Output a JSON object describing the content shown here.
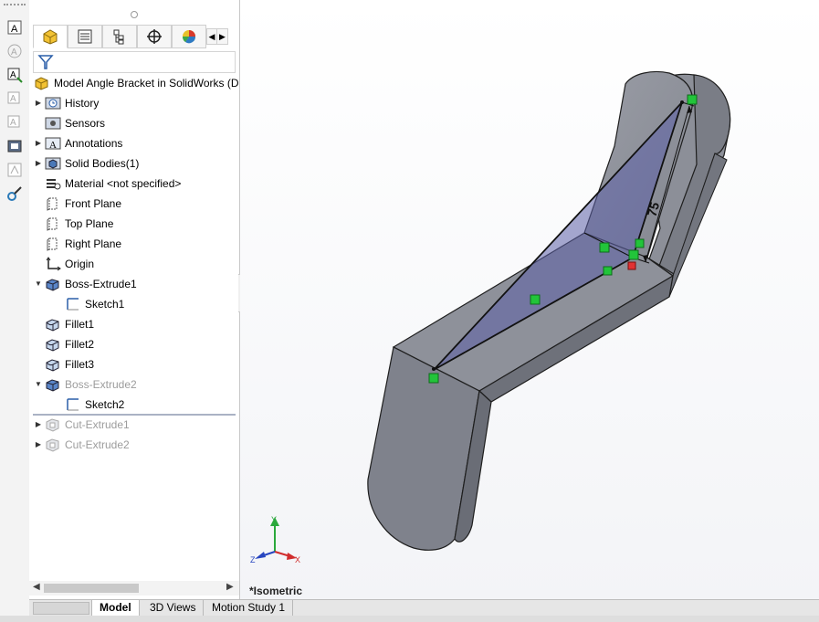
{
  "feature_manager": {
    "tabs": [
      {
        "icon": "feature-tree-icon",
        "active": true
      },
      {
        "icon": "property-manager-icon",
        "active": false
      },
      {
        "icon": "configuration-manager-icon",
        "active": false
      },
      {
        "icon": "dimxpert-icon",
        "active": false
      },
      {
        "icon": "display-manager-icon",
        "active": false
      }
    ],
    "filter_icon": "filter-icon",
    "tree": [
      {
        "label": "Model Angle Bracket in SolidWorks  (D",
        "icon": "part-icon",
        "expander": "",
        "indent": 0,
        "suppressed": false
      },
      {
        "label": "History",
        "icon": "history-icon",
        "expander": "▶",
        "indent": 1,
        "suppressed": false
      },
      {
        "label": "Sensors",
        "icon": "sensors-icon",
        "expander": "",
        "indent": 1,
        "suppressed": false
      },
      {
        "label": "Annotations",
        "icon": "annotations-icon",
        "expander": "▶",
        "indent": 1,
        "suppressed": false
      },
      {
        "label": "Solid Bodies(1)",
        "icon": "solid-bodies-icon",
        "expander": "▶",
        "indent": 1,
        "suppressed": false
      },
      {
        "label": "Material <not specified>",
        "icon": "material-icon",
        "expander": "",
        "indent": 1,
        "suppressed": false
      },
      {
        "label": "Front Plane",
        "icon": "plane-icon",
        "expander": "",
        "indent": 1,
        "suppressed": false
      },
      {
        "label": "Top Plane",
        "icon": "plane-icon",
        "expander": "",
        "indent": 1,
        "suppressed": false
      },
      {
        "label": "Right Plane",
        "icon": "plane-icon",
        "expander": "",
        "indent": 1,
        "suppressed": false
      },
      {
        "label": "Origin",
        "icon": "origin-icon",
        "expander": "",
        "indent": 1,
        "suppressed": false
      },
      {
        "label": "Boss-Extrude1",
        "icon": "extrude-icon",
        "expander": "▼",
        "indent": 1,
        "suppressed": false
      },
      {
        "label": "Sketch1",
        "icon": "sketch-icon",
        "expander": "",
        "indent": 2,
        "suppressed": false
      },
      {
        "label": "Fillet1",
        "icon": "fillet-icon",
        "expander": "",
        "indent": 1,
        "suppressed": false
      },
      {
        "label": "Fillet2",
        "icon": "fillet-icon",
        "expander": "",
        "indent": 1,
        "suppressed": false
      },
      {
        "label": "Fillet3",
        "icon": "fillet-icon",
        "expander": "",
        "indent": 1,
        "suppressed": false
      },
      {
        "label": "Boss-Extrude2",
        "icon": "extrude-icon",
        "expander": "▼",
        "indent": 1,
        "suppressed": true
      },
      {
        "label": "Sketch2",
        "icon": "sketch-icon",
        "expander": "",
        "indent": 2,
        "suppressed": false
      },
      {
        "label": "Cut-Extrude1",
        "icon": "cut-extrude-icon",
        "expander": "▶",
        "indent": 1,
        "suppressed": true
      },
      {
        "label": "Cut-Extrude2",
        "icon": "cut-extrude-icon",
        "expander": "▶",
        "indent": 1,
        "suppressed": true
      }
    ]
  },
  "command_strip": [
    "note-icon",
    "balloon-icon",
    "auto-balloon-icon",
    "surface-finish-icon",
    "weld-symbol-icon",
    "hole-callout-icon",
    "datum-icon",
    "smart-dimension-icon"
  ],
  "viewport": {
    "view_label": "*Isometric",
    "dimension_text": "75",
    "triad": {
      "x": "X",
      "y": "Y",
      "z": "Z"
    },
    "heads_up_icons": [
      "zoom-to-fit-icon",
      "zoom-to-area-icon",
      "previous-view-icon",
      "section-view-icon",
      "view-orientation-icon"
    ]
  },
  "bottom_tabs": [
    "Model",
    "3D Views",
    "Motion Study 1"
  ],
  "colors": {
    "model_face": "#7f828c",
    "sketch_face": "#6f72a8",
    "relation_green": "#22c43a",
    "accent_red": "#e23232"
  }
}
